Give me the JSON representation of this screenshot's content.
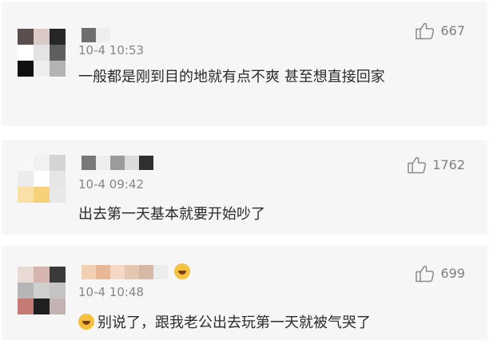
{
  "comments": [
    {
      "time": "10-4 10:53",
      "text": "一般都是刚到目的地就有点不爽 甚至想直接回家",
      "likes": "667",
      "avatar_colors": [
        "#5a4e4f",
        "#d9c9c7",
        "#262626",
        "#ffffff",
        "#e3e3e3",
        "#5e5e5e",
        "#101010",
        "#ededed",
        "#b3b3b3"
      ],
      "username_colors": [
        "#6e6e6e",
        "#eeeeee"
      ]
    },
    {
      "time": "10-4 09:42",
      "text": "出去第一天基本就要开始吵了",
      "likes": "1762",
      "avatar_colors": [
        "#f7f7f7",
        "#f1f1f1",
        "#d5d5d5",
        "#ececec",
        "#ffffff",
        "#e6e6e6",
        "#fae0a7",
        "#f5d27a",
        "#e8e8e8"
      ],
      "username_colors": [
        "#787878",
        "#eeeeee",
        "#9b9b9b",
        "#dcdcdc",
        "#2f2f2f"
      ]
    },
    {
      "time": "10-4 10:48",
      "text": "别说了，跟我老公出去玩第一天就被气哭了",
      "likes": "699",
      "emoji": "laughing-emoji",
      "avatar_colors": [
        "#eadad6",
        "#d5b5ae",
        "#3a3a3a",
        "#b6b6b6",
        "#cfcfcf",
        "#c4c4c4",
        "#c47b76",
        "#1f1f1f",
        "#c2b3b2"
      ],
      "username_colors": [
        "#f2d0b4",
        "#e7b796",
        "#f4d8c4",
        "#e4c6b1",
        "#d6b9a4",
        "#ececec",
        "#e5c1a7",
        "#9a8f88",
        "#c7b8ad",
        "#efefef",
        "#a19a96"
      ]
    }
  ],
  "icons": {
    "like": "thumbs-up-icon",
    "mosaic": "pixelated-mosaic"
  }
}
